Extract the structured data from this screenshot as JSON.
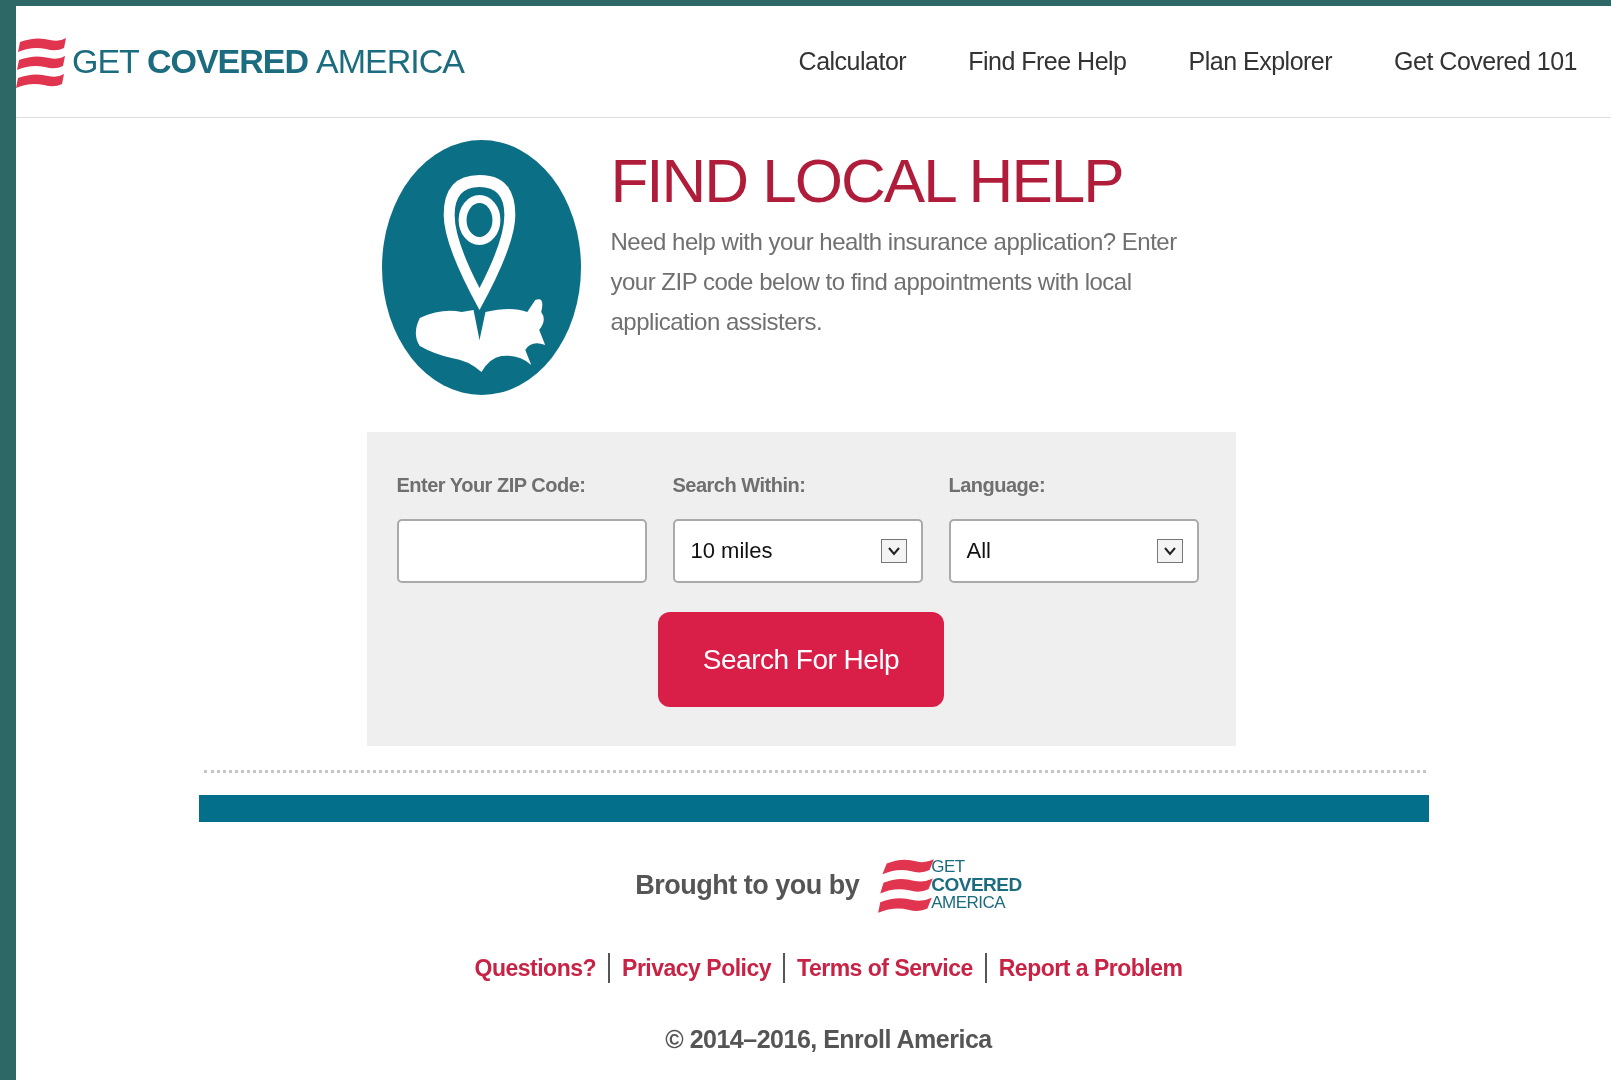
{
  "logo": {
    "words": [
      "GET",
      "COVERED",
      "AMERICA"
    ]
  },
  "nav": [
    "Calculator",
    "Find Free Help",
    "Plan Explorer",
    "Get Covered 101"
  ],
  "hero": {
    "title": "FIND LOCAL HELP",
    "text": "Need help with your health insurance application? Enter your ZIP code below to find appointments with local application assisters."
  },
  "form": {
    "fields": [
      {
        "kind": "text",
        "label": "Enter Your ZIP Code:"
      },
      {
        "kind": "select",
        "label": "Search Within:",
        "value": "10 miles"
      },
      {
        "kind": "select",
        "label": "Language:",
        "value": "All"
      }
    ],
    "button": "Search For Help"
  },
  "footer": {
    "credit": "Brought to you by",
    "credit_logo": [
      "GET",
      "COVERED",
      "AMERICA"
    ],
    "links": [
      "Questions?",
      "Privacy Policy",
      "Terms of Service",
      "Report a Problem"
    ],
    "copyright": "© 2014–2016, Enroll America"
  }
}
